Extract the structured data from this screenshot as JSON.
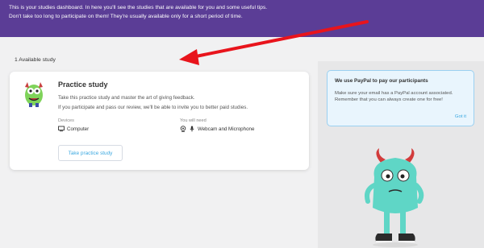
{
  "header": {
    "line1": "This is your studies dashboard. In here you'll see the studies that are available for you and some useful tips.",
    "line2": "Don't take too long to participate on them! They're usually available only for a short period of time."
  },
  "studies": {
    "count_label": "1 Available study",
    "card": {
      "title": "Practice study",
      "desc1": "Take this practice study and master the art of giving feedback.",
      "desc2": "If you participate and pass our review, we'll be able to invite you to better paid studies.",
      "devices_label": "Devices",
      "devices_value": "Computer",
      "need_label": "You will need",
      "need_value": "Webcam and Microphone",
      "button_label": "Take practice study"
    }
  },
  "tip": {
    "title": "We use PayPal to pay our participants",
    "line1": "Make sure your email has a PayPal account associated.",
    "line2": "Remember that you can always create one for free!",
    "action": "Got it"
  },
  "colors": {
    "header": "#5b3d96",
    "accent": "#3ba8e0",
    "arrow": "#e8141c",
    "monster": "#5fd6c6"
  },
  "icons": [
    "computer-icon",
    "webcam-icon",
    "microphone-icon",
    "monster-avatar",
    "monster-illustration",
    "annotation-arrow"
  ]
}
